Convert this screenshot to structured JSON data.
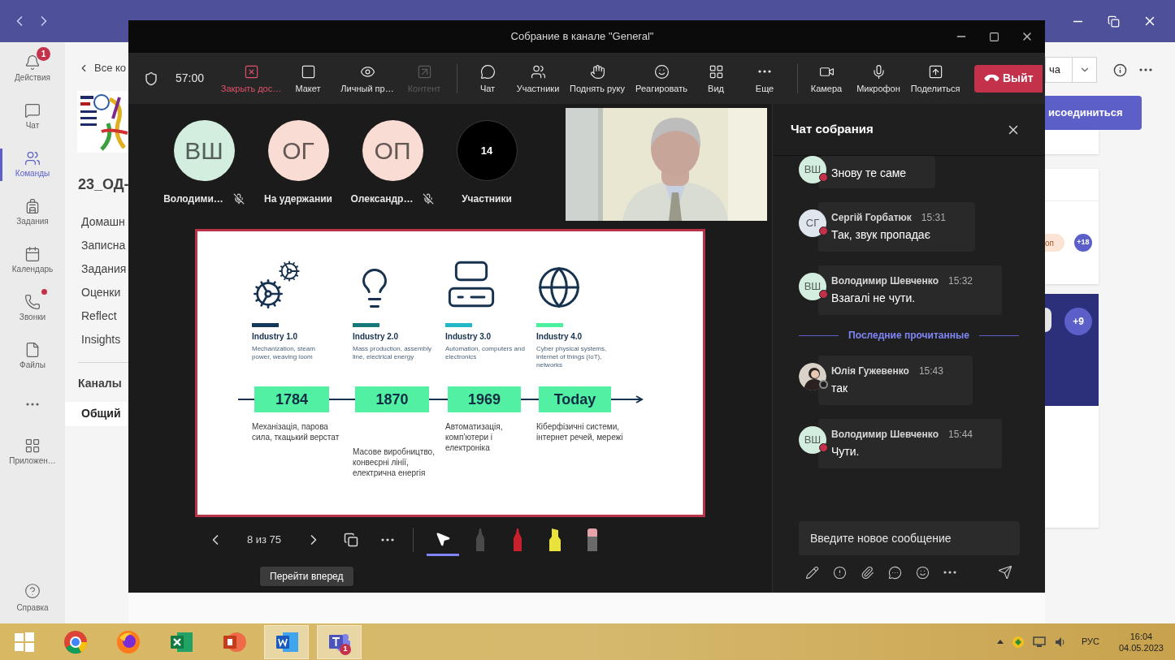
{
  "rail": {
    "items": [
      {
        "label": "Действия",
        "badge": "1",
        "dot": false,
        "selected": false
      },
      {
        "label": "Чат",
        "dot": false,
        "selected": false
      },
      {
        "label": "Команды",
        "dot": false,
        "selected": true
      },
      {
        "label": "Задания",
        "dot": false,
        "selected": false
      },
      {
        "label": "Календарь",
        "dot": false,
        "selected": false
      },
      {
        "label": "Звонки",
        "dot": true,
        "selected": false
      },
      {
        "label": "Файлы",
        "dot": false,
        "selected": false
      },
      {
        "kind": "more",
        "dot": false,
        "selected": false
      },
      {
        "label": "Приложен…",
        "dot": false,
        "selected": false
      }
    ],
    "help": "Справка"
  },
  "team": {
    "back": "Все ко",
    "title": "23_ОД-",
    "menu": [
      "Домашн",
      "Записна",
      "Задания",
      "Оценки",
      "Reflect",
      "Insights"
    ],
    "channels_heading": "Каналы",
    "channels": [
      {
        "label": "Общий",
        "selected": true
      }
    ]
  },
  "right_pane": {
    "dropdown": "ча",
    "join_button": "исоединиться",
    "chip": "оп",
    "count": "+18",
    "count_2": "+9"
  },
  "meeting": {
    "title": "Собрание в канале \"General\"",
    "timer": "57:00",
    "toolbar": [
      [
        {
          "label": "Закрыть дос…",
          "kind": "danger",
          "disabled": false
        },
        {
          "label": "Макет",
          "kind": "normal",
          "disabled": false
        },
        {
          "label": "Личный пр…",
          "kind": "normal",
          "disabled": false
        },
        {
          "label": "Контент",
          "kind": "normal",
          "disabled": true
        }
      ],
      [
        {
          "label": "Чат",
          "kind": "normal",
          "disabled": false
        },
        {
          "label": "Участники",
          "kind": "normal",
          "disabled": false
        },
        {
          "label": "Поднять руку",
          "kind": "normal",
          "disabled": false
        },
        {
          "label": "Реагировать",
          "kind": "normal",
          "disabled": false
        },
        {
          "label": "Вид",
          "kind": "normal",
          "disabled": false
        },
        {
          "label": "Еще",
          "kind": "normal",
          "disabled": false
        }
      ],
      [
        {
          "label": "Камера",
          "kind": "normal",
          "disabled": false
        },
        {
          "label": "Микрофон",
          "kind": "normal",
          "disabled": false
        },
        {
          "label": "Поделиться",
          "kind": "normal",
          "disabled": false
        }
      ]
    ],
    "leave_button": "Выйт",
    "participants": [
      {
        "kind": "avatar",
        "initials": "ВШ",
        "color": "#d3eddf",
        "name": "Володими…",
        "muted": true
      },
      {
        "kind": "avatar",
        "initials": "ОГ",
        "color": "#f9dcd3",
        "name": "На удержании",
        "muted": false
      },
      {
        "kind": "avatar",
        "initials": "ОП",
        "color": "#f9dcd3",
        "name": "Олександр…",
        "muted": true
      },
      {
        "kind": "count",
        "count": "14",
        "name": "Участники"
      }
    ],
    "slide": {
      "columns": [
        {
          "title": "Industry 1.0",
          "description": "Mechanization, steam power, weaving loom",
          "year": "1784",
          "note": "Механізація, парова сила, ткацький верстат",
          "color": "#12395a"
        },
        {
          "title": "Industry 2.0",
          "description": "Mass production, assembly line, electrical energy",
          "year": "1870",
          "note": "Масове виробництво, конвеєрні лінії, електрична енергія",
          "color": "#17787a"
        },
        {
          "title": "Industry 3.0",
          "description": "Automation, computers and electronics",
          "year": "1969",
          "note": "Автоматизація, комп’ютери і електроніка",
          "color": "#22b8c8"
        },
        {
          "title": "Industry 4.0",
          "description": "Cyber physical systems, internet of things (IoT), networks",
          "year": "Today",
          "note": "Кіберфізичні системи, інтернет речей, мережі",
          "color": "#4bf09e"
        }
      ]
    },
    "slide_counter": "8 из 75",
    "tools": [
      {
        "kind": "pointer",
        "selected": true
      },
      {
        "kind": "pen",
        "color": "#4a4a4a",
        "selected": false
      },
      {
        "kind": "pen",
        "color": "#c8202c",
        "selected": false
      },
      {
        "kind": "highlighter",
        "color": "#e8e23a",
        "selected": false
      },
      {
        "kind": "eraser",
        "color": "#e8a3aa",
        "selected": false
      }
    ],
    "tooltip": "Перейти вперед"
  },
  "chat": {
    "title": "Чат собрания",
    "messages": [
      {
        "kind": "message",
        "avatar": {
          "kind": "initials",
          "text": "ВШ",
          "color": "#d3eddf"
        },
        "busy": true,
        "text": "Знову те саме"
      },
      {
        "kind": "message",
        "avatar": {
          "kind": "initials",
          "text": "СГ",
          "color": "#dfe6ee"
        },
        "busy": true,
        "author": "Сергій Горбатюк",
        "time": "15:31",
        "text": "Так, звук пропадає"
      },
      {
        "kind": "message",
        "avatar": {
          "kind": "initials",
          "text": "ВШ",
          "color": "#d3eddf"
        },
        "busy": true,
        "author": "Володимир Шевченко",
        "time": "15:32",
        "text": "Взагалі не чути."
      },
      {
        "kind": "divider",
        "text": "Последние прочитанные"
      },
      {
        "kind": "message",
        "busy": false,
        "author": "Юлія Гужевенко",
        "time": "15:43",
        "text": "так"
      },
      {
        "kind": "message",
        "avatar": {
          "kind": "initials",
          "text": "ВШ",
          "color": "#d3eddf"
        },
        "busy": true,
        "author": "Володимир Шевченко",
        "time": "15:44",
        "text": "Чути."
      }
    ],
    "compose": {
      "placeholder": "Введите новое сообщение"
    }
  },
  "taskbar": {
    "apps": [
      {
        "kind": "chrome",
        "active": false
      },
      {
        "kind": "firefox",
        "active": false
      },
      {
        "kind": "excel",
        "active": false
      },
      {
        "kind": "powerpoint",
        "active": false
      },
      {
        "kind": "word",
        "active": true
      },
      {
        "kind": "teams",
        "active": true,
        "badge": "1"
      }
    ],
    "language": "РУС",
    "time": "16:04",
    "date": "04.05.2023"
  }
}
